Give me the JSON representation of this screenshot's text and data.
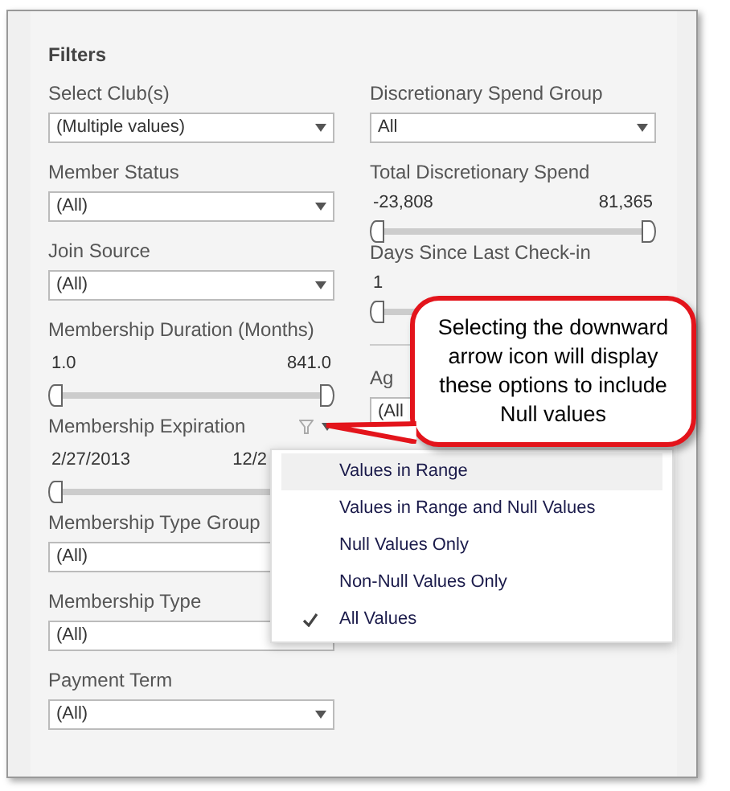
{
  "panel": {
    "title": "Filters"
  },
  "left_filters": [
    {
      "kind": "dropdown",
      "label": "Select Club(s)",
      "value": "(Multiple values)"
    },
    {
      "kind": "dropdown",
      "label": "Member Status",
      "value": "(All)"
    },
    {
      "kind": "dropdown",
      "label": "Join Source",
      "value": "(All)"
    },
    {
      "kind": "range",
      "label": "Membership Duration (Months)",
      "min": "1.0",
      "max": "841.0",
      "level": 1
    },
    {
      "kind": "range",
      "label": "Membership Expiration",
      "min": "2/27/2013",
      "max": "12/2",
      "level": 1,
      "menu_open": true
    },
    {
      "kind": "dropdown",
      "label": "Membership Type Group",
      "value": "(All)"
    },
    {
      "kind": "dropdown",
      "label": "Membership Type",
      "value": "(All)"
    },
    {
      "kind": "dropdown",
      "label": "Payment Term",
      "value": "(All)"
    }
  ],
  "right_filters": [
    {
      "kind": "dropdown",
      "label": "Discretionary Spend Group",
      "value": "All"
    },
    {
      "kind": "range",
      "label": "Total Discretionary Spend",
      "min": "-23,808",
      "max": "81,365",
      "level": 1
    },
    {
      "kind": "range",
      "label": "Days Since Last Check-in",
      "min": "1",
      "level": 1
    },
    {
      "kind": "divider"
    },
    {
      "kind": "dropdown",
      "label": "Ag",
      "value": "(All"
    }
  ],
  "null_menu": {
    "items": [
      {
        "label": "Values in Range",
        "highlighted": true,
        "checked": false
      },
      {
        "label": "Values in Range and Null Values",
        "highlighted": false,
        "checked": false
      },
      {
        "label": "Null Values Only",
        "highlighted": false,
        "checked": false
      },
      {
        "label": "Non-Null Values Only",
        "highlighted": false,
        "checked": false
      },
      {
        "label": "All Values",
        "highlighted": false,
        "checked": true
      }
    ]
  },
  "callout": {
    "text": "Selecting the downward arrow icon will display these options to include Null values"
  }
}
